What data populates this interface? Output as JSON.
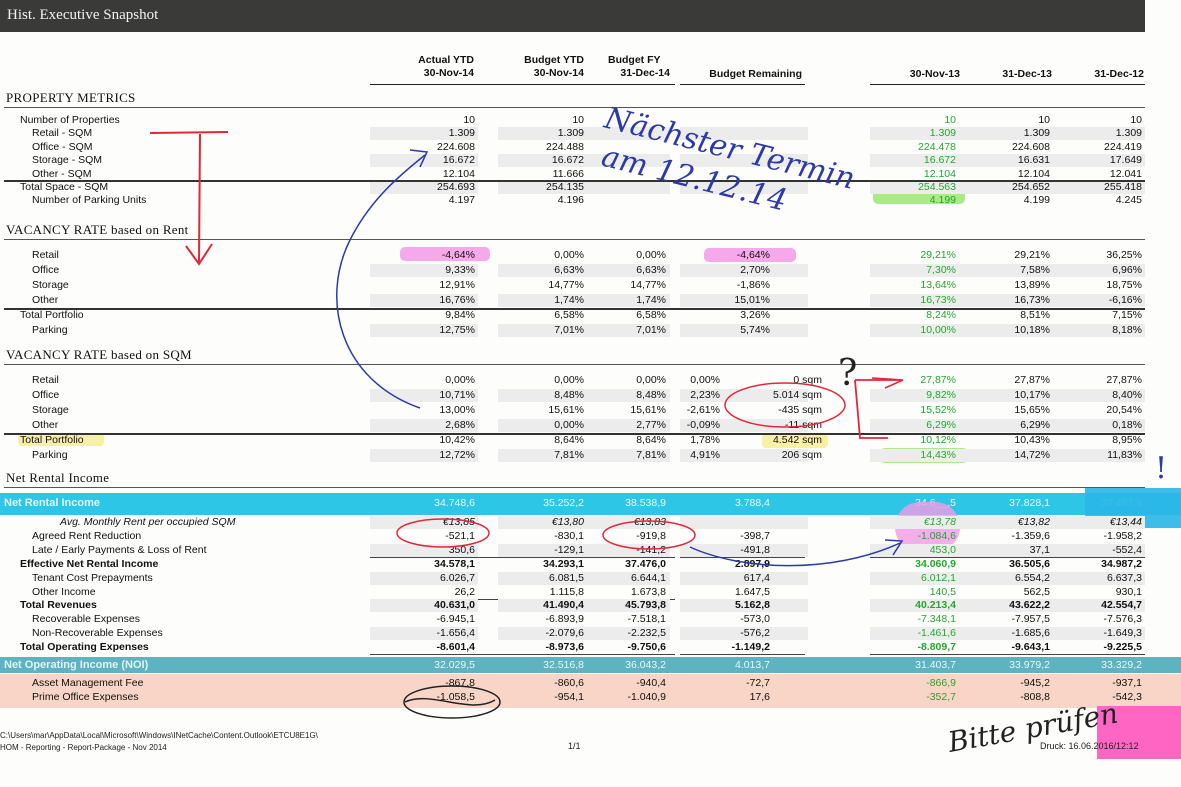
{
  "title": "Hist. Executive Snapshot",
  "headers": {
    "actual_ytd": [
      "Actual YTD",
      "30-Nov-14"
    ],
    "budget_ytd": [
      "Budget YTD",
      "30-Nov-14"
    ],
    "budget_fy": [
      "Budget FY",
      "31-Dec-14"
    ],
    "budget_remaining": "Budget Remaining",
    "h1": "30-Nov-13",
    "h2": "31-Dec-13",
    "h3": "31-Dec-12"
  },
  "sections": {
    "property": "PROPERTY METRICS",
    "vac_rent": "VACANCY RATE based on Rent",
    "vac_sqm": "VACANCY RATE based on SQM",
    "nri": "Net Rental Income"
  },
  "property_rows": [
    {
      "label": "Number of Properties",
      "indent": 1,
      "a": "10",
      "b": "10",
      "c": "",
      "d": "",
      "h1": "10",
      "h2": "10",
      "h3": "10"
    },
    {
      "label": "Retail - SQM",
      "indent": 2,
      "a": "1.309",
      "b": "1.309",
      "c": "",
      "d": "",
      "h1": "1.309",
      "h2": "1.309",
      "h3": "1.309"
    },
    {
      "label": "Office - SQM",
      "indent": 2,
      "a": "224.608",
      "b": "224.488",
      "c": "",
      "d": "",
      "h1": "224.478",
      "h2": "224.608",
      "h3": "224.419"
    },
    {
      "label": "Storage - SQM",
      "indent": 2,
      "a": "16.672",
      "b": "16.672",
      "c": "",
      "d": "",
      "h1": "16.672",
      "h2": "16.631",
      "h3": "17.649"
    },
    {
      "label": "Other - SQM",
      "indent": 2,
      "a": "12.104",
      "b": "11.666",
      "c": "",
      "d": "",
      "h1": "12.104",
      "h2": "12.104",
      "h3": "12.041"
    },
    {
      "label": "Total Space - SQM",
      "indent": 1,
      "a": "254.693",
      "b": "254.135",
      "c": "",
      "d": "",
      "h1": "254.563",
      "h2": "254.652",
      "h3": "255.418"
    },
    {
      "label": "Number of Parking Units",
      "indent": 2,
      "a": "4.197",
      "b": "4.196",
      "c": "",
      "d": "",
      "h1": "4.199",
      "h2": "4.199",
      "h3": "4.245"
    }
  ],
  "vac_rent_rows": [
    {
      "label": "Retail",
      "indent": 2,
      "a": "-4,64%",
      "b": "0,00%",
      "c": "0,00%",
      "d": "-4,64%",
      "h1": "29,21%",
      "h2": "29,21%",
      "h3": "36,25%"
    },
    {
      "label": "Office",
      "indent": 2,
      "a": "9,33%",
      "b": "6,63%",
      "c": "6,63%",
      "d": "2,70%",
      "h1": "7,30%",
      "h2": "7,58%",
      "h3": "6,96%"
    },
    {
      "label": "Storage",
      "indent": 2,
      "a": "12,91%",
      "b": "14,77%",
      "c": "14,77%",
      "d": "-1,86%",
      "h1": "13,64%",
      "h2": "13,89%",
      "h3": "18,75%"
    },
    {
      "label": "Other",
      "indent": 2,
      "a": "16,76%",
      "b": "1,74%",
      "c": "1,74%",
      "d": "15,01%",
      "h1": "16,73%",
      "h2": "16,73%",
      "h3": "-6,16%"
    },
    {
      "label": "Total Portfolio",
      "indent": 1,
      "a": "9,84%",
      "b": "6,58%",
      "c": "6,58%",
      "d": "3,26%",
      "h1": "8,24%",
      "h2": "8,51%",
      "h3": "7,15%"
    },
    {
      "label": "Parking",
      "indent": 2,
      "a": "12,75%",
      "b": "7,01%",
      "c": "7,01%",
      "d": "5,74%",
      "h1": "10,00%",
      "h2": "10,18%",
      "h3": "8,18%"
    }
  ],
  "vac_sqm_rows": [
    {
      "label": "Retail",
      "indent": 2,
      "a": "0,00%",
      "b": "0,00%",
      "c": "0,00%",
      "d": "0,00%",
      "e": "0 sqm",
      "h1": "27,87%",
      "h2": "27,87%",
      "h3": "27,87%"
    },
    {
      "label": "Office",
      "indent": 2,
      "a": "10,71%",
      "b": "8,48%",
      "c": "8,48%",
      "d": "2,23%",
      "e": "5.014 sqm",
      "h1": "9,82%",
      "h2": "10,17%",
      "h3": "8,40%"
    },
    {
      "label": "Storage",
      "indent": 2,
      "a": "13,00%",
      "b": "15,61%",
      "c": "15,61%",
      "d": "-2,61%",
      "e": "-435 sqm",
      "h1": "15,52%",
      "h2": "15,65%",
      "h3": "20,54%"
    },
    {
      "label": "Other",
      "indent": 2,
      "a": "2,68%",
      "b": "0,00%",
      "c": "2,77%",
      "d": "-0,09%",
      "e": "-11 sqm",
      "h1": "6,29%",
      "h2": "6,29%",
      "h3": "0,18%"
    },
    {
      "label": "Total Portfolio",
      "indent": 1,
      "a": "10,42%",
      "b": "8,64%",
      "c": "8,64%",
      "d": "1,78%",
      "e": "4.542 sqm",
      "h1": "10,12%",
      "h2": "10,43%",
      "h3": "8,95%"
    },
    {
      "label": "Parking",
      "indent": 2,
      "a": "12,72%",
      "b": "7,81%",
      "c": "7,81%",
      "d": "4,91%",
      "e": "206 sqm",
      "h1": "14,43%",
      "h2": "14,72%",
      "h3": "11,83%"
    }
  ],
  "nri_band": {
    "label": "Net Rental Income",
    "a": "34.748,6",
    "b": "35.252,2",
    "c": "38.538,9",
    "d": "3.788,4",
    "h1": "34.6__,5",
    "h2": "37.828,1",
    "h3": "37.497,9"
  },
  "nri_rows": [
    {
      "label": "Avg. Monthly Rent per occupied SQM",
      "style": "italic",
      "indent": 3,
      "a": "€13,85",
      "b": "€13,80",
      "c": "€13,83",
      "d": "",
      "h1": "€13,78",
      "h2": "€13,82",
      "h3": "€13,44"
    },
    {
      "label": "Agreed Rent Reduction",
      "style": "",
      "indent": 2,
      "a": "-521,1",
      "b": "-830,1",
      "c": "-919,8",
      "d": "-398,7",
      "h1": "-1.084,6",
      "h2": "-1.359,6",
      "h3": "-1.958,2"
    },
    {
      "label": "Late / Early Payments & Loss of Rent",
      "style": "",
      "indent": 2,
      "a": "350,6",
      "b": "-129,1",
      "c": "-141,2",
      "d": "-491,8",
      "h1": "453,0",
      "h2": "37,1",
      "h3": "-552,4"
    },
    {
      "label": "Effective Net Rental Income",
      "style": "bold",
      "indent": 1,
      "a": "34.578,1",
      "b": "34.293,1",
      "c": "37.476,0",
      "d": "2.897,9",
      "h1": "34.060,9",
      "h2": "36.505,6",
      "h3": "34.987,2"
    },
    {
      "label": "Tenant Cost Prepayments",
      "style": "",
      "indent": 2,
      "a": "6.026,7",
      "b": "6.081,5",
      "c": "6.644,1",
      "d": "617,4",
      "h1": "6.012,1",
      "h2": "6.554,2",
      "h3": "6.637,3"
    },
    {
      "label": "Other Income",
      "style": "",
      "indent": 2,
      "a": "26,2",
      "b": "1.115,8",
      "c": "1.673,8",
      "d": "1.647,5",
      "h1": "140,5",
      "h2": "562,5",
      "h3": "930,1"
    },
    {
      "label": "Total Revenues",
      "style": "bold",
      "indent": 1,
      "a": "40.631,0",
      "b": "41.490,4",
      "c": "45.793,8",
      "d": "5.162,8",
      "h1": "40.213,4",
      "h2": "43.622,2",
      "h3": "42.554,7"
    },
    {
      "label": "Recoverable Expenses",
      "style": "",
      "indent": 2,
      "a": "-6.945,1",
      "b": "-6.893,9",
      "c": "-7.518,1",
      "d": "-573,0",
      "h1": "-7.348,1",
      "h2": "-7.957,5",
      "h3": "-7.576,3"
    },
    {
      "label": "Non-Recoverable Expenses",
      "style": "",
      "indent": 2,
      "a": "-1.656,4",
      "b": "-2.079,6",
      "c": "-2.232,5",
      "d": "-576,2",
      "h1": "-1.461,6",
      "h2": "-1.685,6",
      "h3": "-1.649,3"
    },
    {
      "label": "Total Operating Expenses",
      "style": "bold",
      "indent": 1,
      "a": "-8.601,4",
      "b": "-8.973,6",
      "c": "-9.750,6",
      "d": "-1.149,2",
      "h1": "-8.809,7",
      "h2": "-9.643,1",
      "h3": "-9.225,5"
    }
  ],
  "noi_band": {
    "label": "Net Operating Income (NOI)",
    "a": "32.029,5",
    "b": "32.516,8",
    "c": "36.043,2",
    "d": "4.013,7",
    "h1": "31.403,7",
    "h2": "33.979,2",
    "h3": "33.329,2"
  },
  "noi_rows": [
    {
      "label": "Asset Management Fee",
      "style": "",
      "indent": 2,
      "a": "-867,8",
      "b": "-860,6",
      "c": "-940,4",
      "d": "-72,7",
      "h1": "-866,9",
      "h2": "-945,2",
      "h3": "-937,1"
    },
    {
      "label": "Prime Office Expenses",
      "style": "",
      "indent": 2,
      "a": "-1.058,5",
      "b": "-954,1",
      "c": "-1.040,9",
      "d": "17,6",
      "h1": "-352,7",
      "h2": "-808,8",
      "h3": "-542,3"
    }
  ],
  "footer": {
    "path": "C:\\Users\\mar\\AppData\\Local\\Microsoft\\Windows\\INetCache\\Content.Outlook\\ETCU8E1G\\",
    "report": "HOM - Reporting - Report-Package - Nov 2014",
    "page": "1/1",
    "print": "Druck: 16.06.2016/12:12"
  },
  "handwriting": {
    "note": [
      "Nächster Termin",
      "am 12.12.14"
    ],
    "signature": "Bitte prüfen",
    "question": "?",
    "exclaim": "!"
  },
  "colors": {
    "green": "#22a82a",
    "nri_band": "#2ec6e6",
    "noi_band": "#5fb2bf",
    "pink_highlight": "#f39ae6",
    "yellow_highlight": "#f7f09a",
    "green_highlight": "#9be870",
    "salmon_band": "#f7c7b5",
    "red_ink": "#e0283a",
    "blue_ink": "#2c3aa8"
  }
}
